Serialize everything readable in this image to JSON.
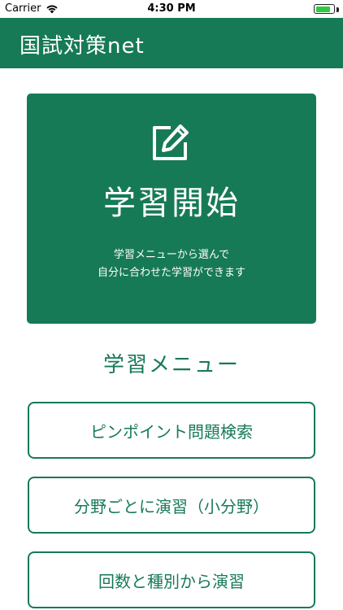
{
  "status_bar": {
    "carrier": "Carrier",
    "time": "4:30 PM",
    "battery_level": 0.85
  },
  "header": {
    "title": "国試対策net"
  },
  "hero": {
    "icon": "edit-icon",
    "title": "学習開始",
    "description_line1": "学習メニューから選んで",
    "description_line2": "自分に合わせた学習ができます"
  },
  "menu": {
    "title": "学習メニュー",
    "items": [
      {
        "label": "ピンポイント問題検索"
      },
      {
        "label": "分野ごとに演習（小分野）"
      },
      {
        "label": "回数と種別から演習"
      }
    ]
  },
  "colors": {
    "accent": "#177a57",
    "background": "#ffffff"
  }
}
